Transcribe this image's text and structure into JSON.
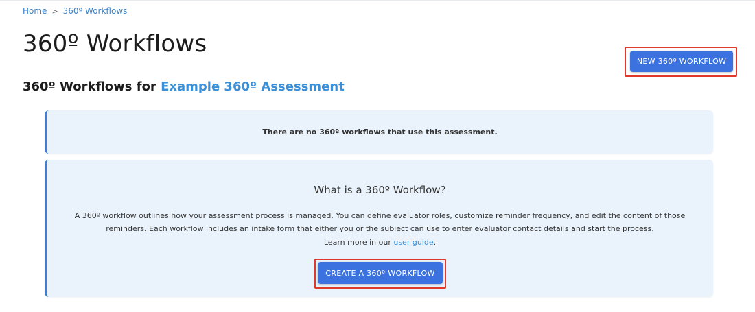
{
  "breadcrumb": {
    "home": "Home",
    "separator": ">",
    "current": "360º Workflows"
  },
  "page": {
    "title": "360º Workflows",
    "subtitle_prefix": "360º Workflows for ",
    "assessment_link": "Example 360º Assessment"
  },
  "toolbar": {
    "new_workflow_label": "NEW 360º WORKFLOW"
  },
  "empty_state": {
    "message": "There are no 360º workflows that use this assessment."
  },
  "info": {
    "title": "What is a 360º Workflow?",
    "body": "A 360º workflow outlines how your assessment process is managed. You can define evaluator roles, customize reminder frequency, and edit the content of those reminders. Each workflow includes an intake form that either you or the subject can use to enter evaluator contact details and start the process.",
    "learn_prefix": "Learn more in our ",
    "learn_link": "user guide",
    "learn_suffix": ".",
    "create_label": "CREATE A 360º WORKFLOW"
  },
  "colors": {
    "accent": "#3c71e0",
    "link": "#3b8fd6",
    "card_bg": "#eaf3fb",
    "highlight": "#e0392b"
  }
}
